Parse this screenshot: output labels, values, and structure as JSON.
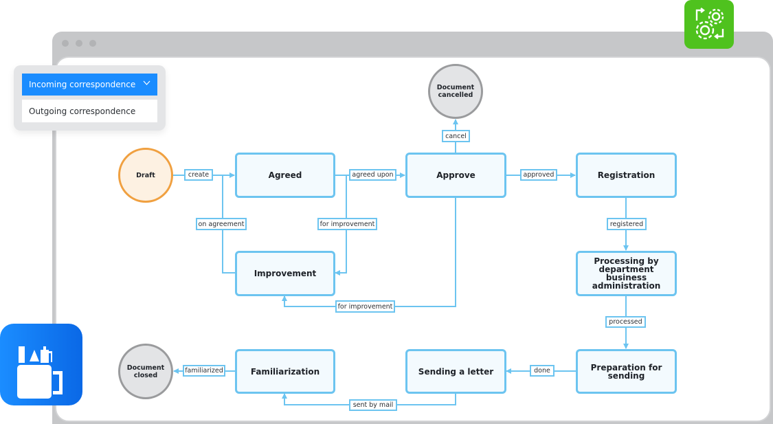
{
  "dropdown": {
    "selected": "Incoming correspondence",
    "options": [
      "Outgoing correspondence"
    ]
  },
  "icons": {
    "settings_badge": "gears-workflow-icon",
    "stationery_badge": "stationery-mug-icon"
  },
  "colors": {
    "accent_blue": "#1a8cff",
    "badge_green": "#4fc21e",
    "connector": "#6cc4f0",
    "draft_stroke": "#f0a040"
  },
  "diagram": {
    "nodes": {
      "draft": "Draft",
      "agreed": "Agreed",
      "improvement": "Improvement",
      "approve": "Approve",
      "registration": "Registration",
      "processing": "Processing by department business administration",
      "doc_cancelled": "Document cancelled",
      "preparation": "Preparation for sending",
      "sending": "Sending a letter",
      "familiarization": "Familiarization",
      "doc_closed": "Document closed"
    },
    "transitions": {
      "create": "create",
      "agreed_upon": "agreed upon",
      "approved": "approved",
      "cancel": "cancel",
      "on_agreement": "on agreement",
      "for_improvement_1": "for improvement",
      "for_improvement_2": "for improvement",
      "registered": "registered",
      "processed": "processed",
      "done": "done",
      "familiarized": "familiarized",
      "sent_by_mail": "sent by mail"
    }
  }
}
